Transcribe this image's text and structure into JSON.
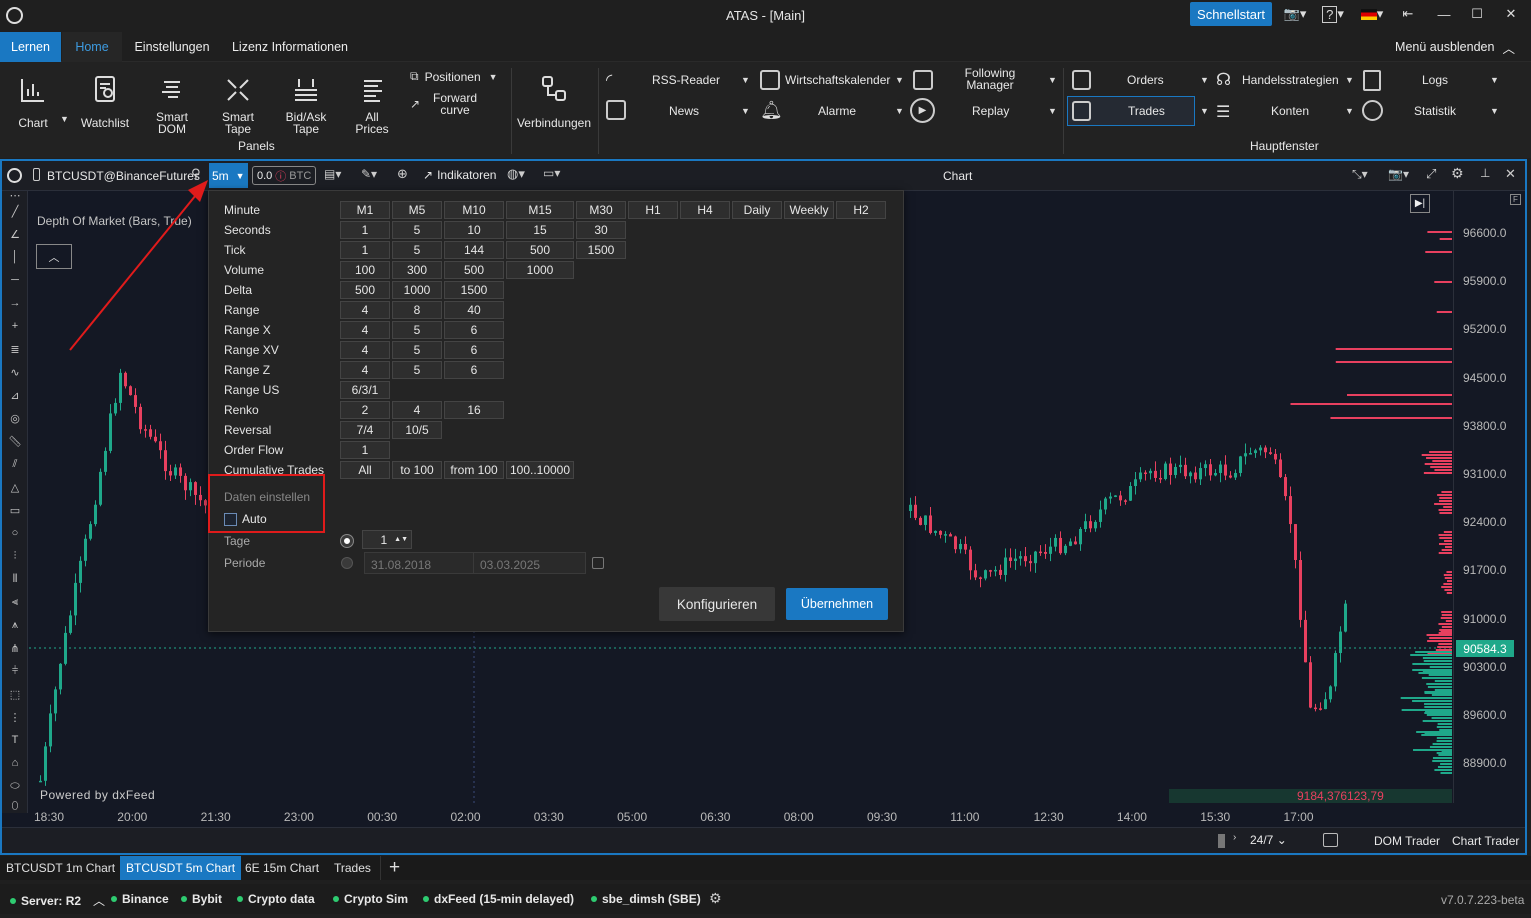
{
  "window": {
    "title": "ATAS - [Main]",
    "quickstart": "Schnellstart"
  },
  "menu": {
    "tabs": [
      "Lernen",
      "Home",
      "Einstellungen",
      "Lizenz Informationen"
    ],
    "hide_menu": "Menü ausblenden"
  },
  "ribbon": {
    "chart": "Chart",
    "watchlist": "Watchlist",
    "smart_dom": "Smart DOM",
    "smart_tape": "Smart Tape",
    "bidask_tape": "Bid/Ask Tape",
    "all_prices": "All Prices",
    "positionen": "Positionen",
    "forward_curve": "Forward curve",
    "panels": "Panels",
    "verbindungen": "Verbindungen",
    "rss": "RSS-Reader",
    "news": "News",
    "wirtschaft": "Wirtschaftskalender",
    "alarme": "Alarme",
    "following": "Following Manager",
    "replay": "Replay",
    "orders": "Orders",
    "trades": "Trades",
    "handel": "Handelsstrategien",
    "konten": "Konten",
    "logs": "Logs",
    "statistik": "Statistik",
    "hauptfenster": "Hauptfenster"
  },
  "chart": {
    "symbol": "BTCUSDT@BinanceFutures",
    "timeframe": "5m",
    "volume_value": "0.0",
    "volume_unit": "BTC",
    "indicators": "Indikatoren",
    "title": "Chart",
    "dom_label": "Depth Of Market (Bars, True)",
    "powered": "Powered by dxFeed",
    "price_labels": [
      "96600.0",
      "95900.0",
      "95200.0",
      "94500.0",
      "93800.0",
      "93100.0",
      "92400.0",
      "91700.0",
      "91000.0",
      "90300.0",
      "89600.0",
      "88900.0"
    ],
    "current_price": "90584.3",
    "volume_readout": "9184,376123,79",
    "time_labels": [
      "18:30",
      "20:00",
      "21:30",
      "23:00",
      "00:30",
      "02:00",
      "03:30",
      "05:00",
      "06:30",
      "08:00",
      "09:30",
      "11:00",
      "12:30",
      "14:00",
      "15:30",
      "17:00"
    ],
    "session": "24/7",
    "dom_trader": "DOM Trader",
    "chart_trader": "Chart Trader"
  },
  "timeframes": {
    "headers": [
      "M1",
      "M5",
      "M10",
      "M15",
      "M30",
      "H1",
      "H4",
      "Daily",
      "Weekly",
      "H2"
    ],
    "rows": [
      {
        "label": "Minute",
        "values": []
      },
      {
        "label": "Seconds",
        "values": [
          "1",
          "5",
          "10",
          "15",
          "30"
        ]
      },
      {
        "label": "Tick",
        "values": [
          "1",
          "5",
          "144",
          "500",
          "1500"
        ]
      },
      {
        "label": "Volume",
        "values": [
          "100",
          "300",
          "500",
          "1000"
        ]
      },
      {
        "label": "Delta",
        "values": [
          "500",
          "1000",
          "1500"
        ]
      },
      {
        "label": "Range",
        "values": [
          "4",
          "8",
          "40"
        ]
      },
      {
        "label": "Range X",
        "values": [
          "4",
          "5",
          "6"
        ]
      },
      {
        "label": "Range XV",
        "values": [
          "4",
          "5",
          "6"
        ]
      },
      {
        "label": "Range Z",
        "values": [
          "4",
          "5",
          "6"
        ]
      },
      {
        "label": "Range US",
        "values": [
          "6/3/1"
        ]
      },
      {
        "label": "Renko",
        "values": [
          "2",
          "4",
          "16"
        ]
      },
      {
        "label": "Reversal",
        "values": [
          "7/4",
          "10/5"
        ]
      },
      {
        "label": "Order Flow",
        "values": [
          "1"
        ]
      },
      {
        "label": "Cumulative Trades",
        "values": [
          "All",
          "to 100",
          "from 100",
          "100..10000"
        ]
      }
    ],
    "daten": "Daten einstellen",
    "auto": "Auto",
    "tage": "Tage",
    "tage_value": "1",
    "periode": "Periode",
    "date_from": "31.08.2018",
    "date_to": "03.03.2025",
    "configure": "Konfigurieren",
    "apply": "Übernehmen"
  },
  "tabs": [
    "BTCUSDT 1m Chart",
    "BTCUSDT 5m Chart",
    "6E 15m Chart",
    "Trades"
  ],
  "status": {
    "server": "Server: R2",
    "connections": [
      "Binance",
      "Bybit",
      "Crypto data",
      "Crypto Sim",
      "dxFeed (15-min delayed)",
      "sbe_dimsh (SBE)"
    ],
    "version": "v7.0.7.223-beta"
  },
  "colors": {
    "accent": "#1a78c2",
    "bear": "#e8405f",
    "bull": "#1fa88a"
  }
}
